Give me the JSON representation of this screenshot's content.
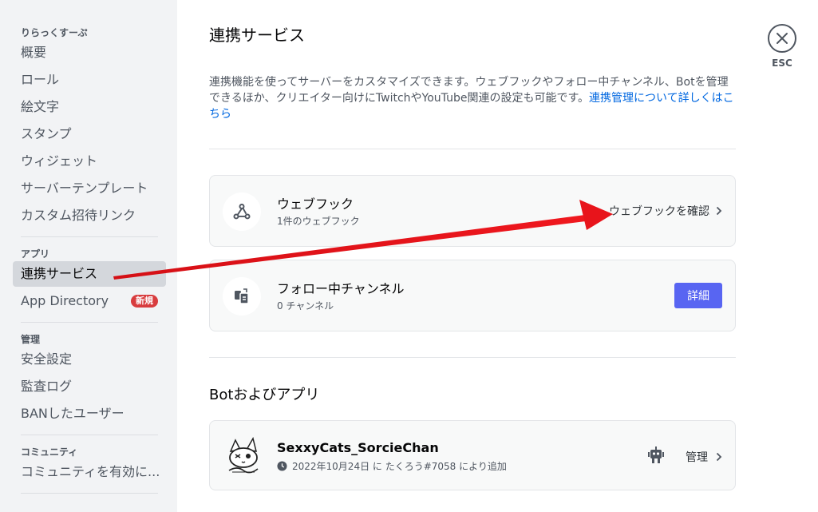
{
  "sidebar": {
    "server_header": "りらっくすーぷ",
    "server_items": [
      "概要",
      "ロール",
      "絵文字",
      "スタンプ",
      "ウィジェット",
      "サーバーテンプレート",
      "カスタム招待リンク"
    ],
    "apps_header": "アプリ",
    "apps_items": [
      {
        "label": "連携サービス"
      },
      {
        "label": "App Directory",
        "badge": "新規"
      }
    ],
    "manage_header": "管理",
    "manage_items": [
      "安全設定",
      "監査ログ",
      "BANしたユーザー"
    ],
    "community_header": "コミュニティ",
    "community_items": [
      "コミュニティを有効に..."
    ]
  },
  "main": {
    "title": "連携サービス",
    "close": {
      "label": "ESC",
      "icon": "close-icon"
    },
    "description": "連携機能を使ってサーバーをカスタマイズできます。ウェブフックやフォロー中チャンネル、Botを管理できるほか、クリエイター向けにTwitchやYouTube関連の設定も可能です。",
    "description_link": "連携管理について詳しくはこちら",
    "webhook": {
      "title": "ウェブフック",
      "subtitle": "1件のウェブフック",
      "action": "ウェブフックを確認"
    },
    "followed": {
      "title": "フォロー中チャンネル",
      "subtitle": "0 チャンネル",
      "action": "詳細"
    },
    "bots_title": "Botおよびアプリ",
    "bot": {
      "name": "SexxyCats_SorcieChan",
      "meta": "2022年10月24日 に たくろう#7058 により追加",
      "action": "管理"
    }
  },
  "colors": {
    "accent": "#5865f2",
    "link": "#0067e0",
    "badge": "#d83c3e",
    "annotation_arrow": "#e8141b"
  }
}
